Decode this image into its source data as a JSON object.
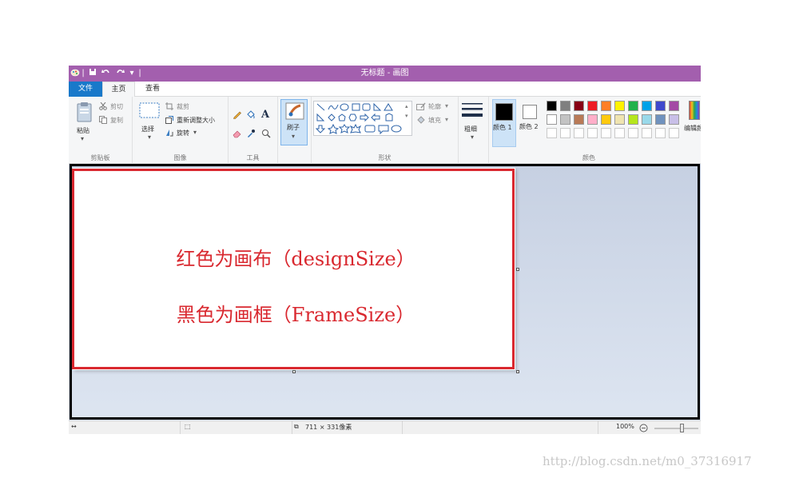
{
  "window": {
    "title": "无标题 - 画图"
  },
  "tabs": [
    {
      "label": "文件"
    },
    {
      "label": "主页"
    },
    {
      "label": "查看"
    }
  ],
  "ribbon": {
    "clipboard": {
      "group_label": "剪贴板",
      "paste": "粘贴",
      "cut": "剪切",
      "copy": "复制"
    },
    "image": {
      "group_label": "图像",
      "select": "选择",
      "crop": "裁剪",
      "resize": "重新调整大小",
      "rotate": "旋转"
    },
    "tools": {
      "group_label": "工具"
    },
    "brushes": {
      "label": "刷子"
    },
    "shapes": {
      "group_label": "形状",
      "outline": "轮廓",
      "fill": "填充"
    },
    "size": {
      "label": "粗细"
    },
    "colors": {
      "group_label": "颜色",
      "color1_label": "颜色 1",
      "color2_label": "颜色 2",
      "edit_label": "编辑颜色",
      "color1": "#000000",
      "color2": "#ffffff",
      "palette_row1": [
        "#000000",
        "#7f7f7f",
        "#880015",
        "#ed1c24",
        "#ff7f27",
        "#fff200",
        "#22b14c",
        "#00a2e8",
        "#3f48cc",
        "#a349a4"
      ],
      "palette_row2": [
        "#ffffff",
        "#c3c3c3",
        "#b97a57",
        "#ffaec9",
        "#ffc90e",
        "#efe4b0",
        "#b5e61d",
        "#99d9ea",
        "#7092be",
        "#c8bfe7"
      ]
    }
  },
  "status": {
    "dimensions": "711 × 331像素",
    "zoom": "100%"
  },
  "annotations": {
    "design": "红色为画布（designSize）",
    "frame": "黑色为画框（FrameSize）",
    "design_color": "#d9282f",
    "frame_color": "#000000"
  },
  "watermark": "http://blog.csdn.net/m0_37316917"
}
